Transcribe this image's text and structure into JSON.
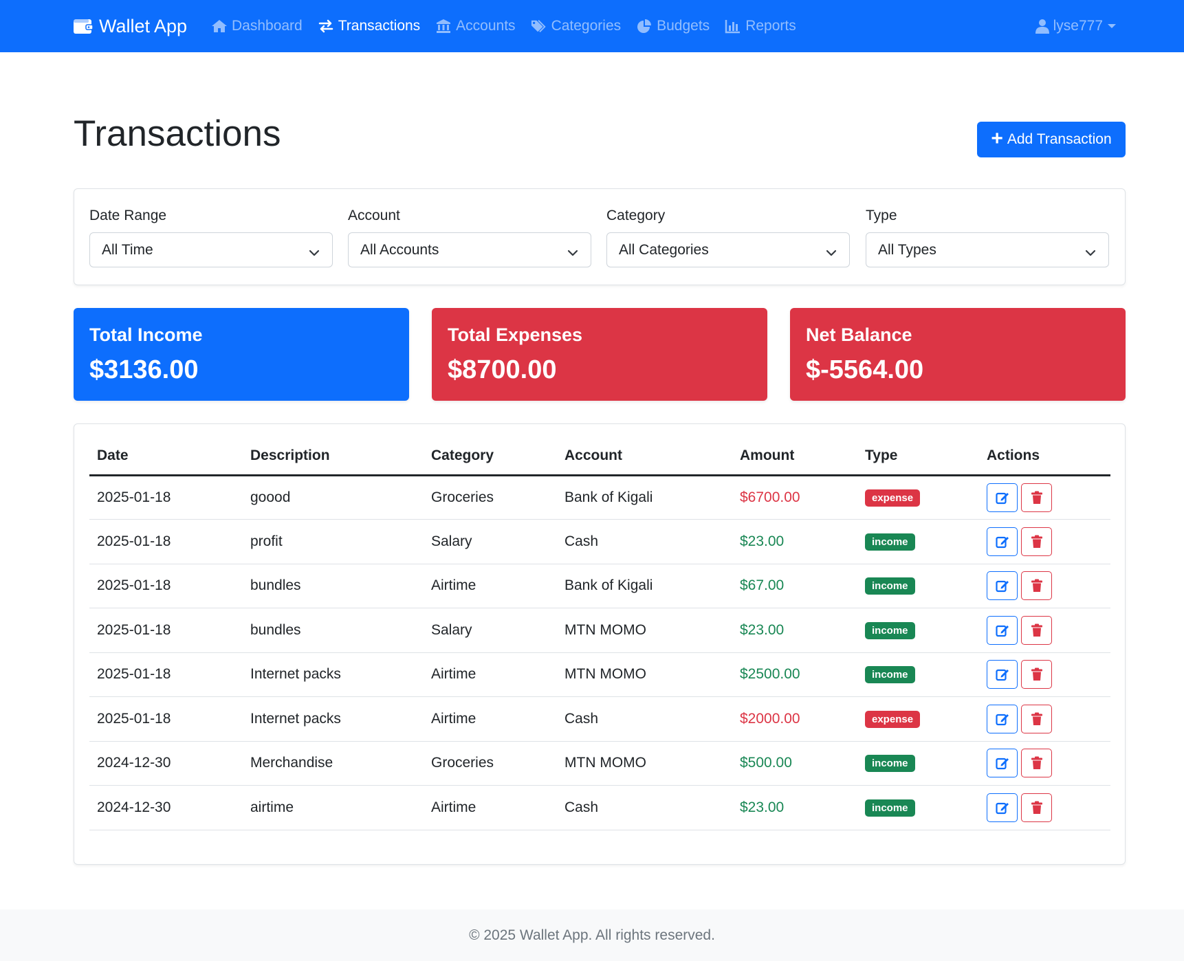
{
  "navbar": {
    "brand": "Wallet App",
    "links": [
      {
        "label": "Dashboard",
        "icon": "home-icon",
        "active": false
      },
      {
        "label": "Transactions",
        "icon": "exchange-icon",
        "active": true
      },
      {
        "label": "Accounts",
        "icon": "bank-icon",
        "active": false
      },
      {
        "label": "Categories",
        "icon": "tags-icon",
        "active": false
      },
      {
        "label": "Budgets",
        "icon": "pie-chart-icon",
        "active": false
      },
      {
        "label": "Reports",
        "icon": "bar-chart-icon",
        "active": false
      }
    ],
    "user": "lyse777"
  },
  "page": {
    "title": "Transactions",
    "add_button": "Add Transaction"
  },
  "filters": {
    "date_range": {
      "label": "Date Range",
      "value": "All Time"
    },
    "account": {
      "label": "Account",
      "value": "All Accounts"
    },
    "category": {
      "label": "Category",
      "value": "All Categories"
    },
    "type": {
      "label": "Type",
      "value": "All Types"
    }
  },
  "summary": {
    "income": {
      "label": "Total Income",
      "value": "$3136.00"
    },
    "expenses": {
      "label": "Total Expenses",
      "value": "$8700.00"
    },
    "net": {
      "label": "Net Balance",
      "value": "$-5564.00"
    }
  },
  "table": {
    "headers": [
      "Date",
      "Description",
      "Category",
      "Account",
      "Amount",
      "Type",
      "Actions"
    ],
    "rows": [
      {
        "date": "2025-01-18",
        "description": "goood",
        "category": "Groceries",
        "account": "Bank of Kigali",
        "amount": "$6700.00",
        "type": "expense"
      },
      {
        "date": "2025-01-18",
        "description": "profit",
        "category": "Salary",
        "account": "Cash",
        "amount": "$23.00",
        "type": "income"
      },
      {
        "date": "2025-01-18",
        "description": "bundles",
        "category": "Airtime",
        "account": "Bank of Kigali",
        "amount": "$67.00",
        "type": "income"
      },
      {
        "date": "2025-01-18",
        "description": "bundles",
        "category": "Salary",
        "account": "MTN MOMO",
        "amount": "$23.00",
        "type": "income"
      },
      {
        "date": "2025-01-18",
        "description": "Internet packs",
        "category": "Airtime",
        "account": "MTN MOMO",
        "amount": "$2500.00",
        "type": "income"
      },
      {
        "date": "2025-01-18",
        "description": "Internet packs",
        "category": "Airtime",
        "account": "Cash",
        "amount": "$2000.00",
        "type": "expense"
      },
      {
        "date": "2024-12-30",
        "description": "Merchandise",
        "category": "Groceries",
        "account": "MTN MOMO",
        "amount": "$500.00",
        "type": "income"
      },
      {
        "date": "2024-12-30",
        "description": "airtime",
        "category": "Airtime",
        "account": "Cash",
        "amount": "$23.00",
        "type": "income"
      }
    ]
  },
  "footer": {
    "text": "© 2025 Wallet App. All rights reserved."
  },
  "colors": {
    "primary": "#0d6efd",
    "danger": "#dc3545",
    "success": "#198754",
    "footer_bg": "#f8f9fa"
  }
}
